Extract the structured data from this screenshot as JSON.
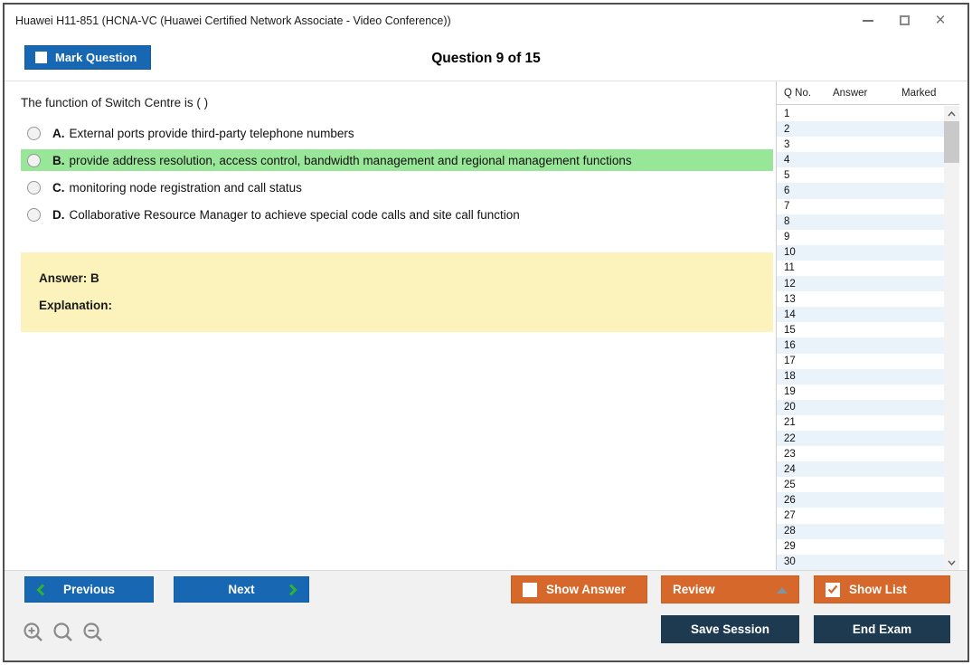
{
  "window": {
    "title": "Huawei H11-851 (HCNA-VC (Huawei Certified Network Associate - Video Conference))"
  },
  "header": {
    "mark_question_label": "Mark Question",
    "mark_question_checked": false,
    "question_counter": "Question 9 of 15"
  },
  "question": {
    "text": "The function of Switch Centre is ( )",
    "options": [
      {
        "letter": "A.",
        "text": "External ports provide third-party telephone numbers",
        "highlighted": false,
        "selected": false
      },
      {
        "letter": "B.",
        "text": "provide address resolution, access control, bandwidth management and regional management functions",
        "highlighted": true,
        "selected": false
      },
      {
        "letter": "C.",
        "text": "monitoring node registration and call status",
        "highlighted": false,
        "selected": false
      },
      {
        "letter": "D.",
        "text": "Collaborative Resource Manager to achieve special code calls and site call function",
        "highlighted": false,
        "selected": false
      }
    ],
    "answer_label": "Answer: B",
    "explanation_label": "Explanation:"
  },
  "question_list": {
    "columns": [
      "Q No.",
      "Answer",
      "Marked"
    ],
    "rows": [
      "1",
      "2",
      "3",
      "4",
      "5",
      "6",
      "7",
      "8",
      "9",
      "10",
      "11",
      "12",
      "13",
      "14",
      "15",
      "16",
      "17",
      "18",
      "19",
      "20",
      "21",
      "22",
      "23",
      "24",
      "25",
      "26",
      "27",
      "28",
      "29",
      "30"
    ]
  },
  "footer": {
    "previous_label": "Previous",
    "next_label": "Next",
    "show_answer_label": "Show Answer",
    "show_answer_checked": false,
    "review_label": "Review",
    "show_list_label": "Show List",
    "show_list_checked": true,
    "save_session_label": "Save Session",
    "end_exam_label": "End Exam"
  },
  "colors": {
    "accent_blue": "#1767b2",
    "accent_orange": "#d5682a",
    "accent_navy": "#1d3a50",
    "highlight_green": "#98e798",
    "answer_box_yellow": "#fbf3bb",
    "row_alt_blue": "#eaf2fa",
    "chevron_green": "#2db52d"
  }
}
